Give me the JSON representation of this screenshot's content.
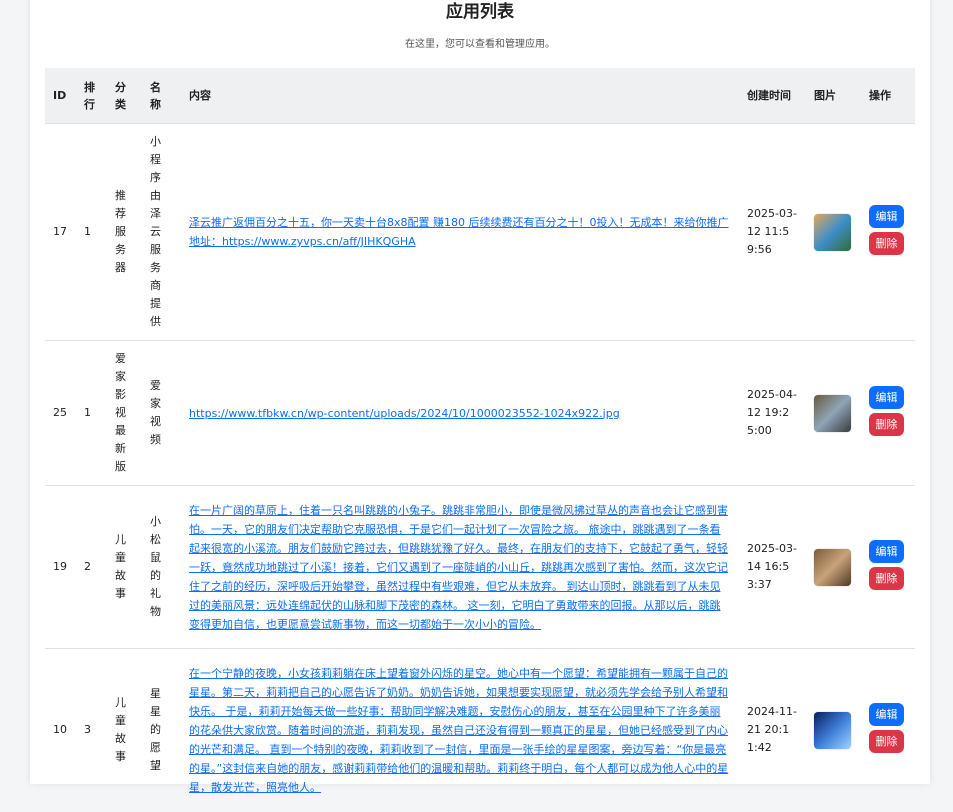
{
  "header": {
    "title": "应用列表",
    "subtitle": "在这里，您可以查看和管理应用。"
  },
  "columns": {
    "id": "ID",
    "rank": "排行",
    "category": "分类",
    "name": "名称",
    "content": "内容",
    "created": "创建时间",
    "image": "图片",
    "actions": "操作"
  },
  "buttons": {
    "edit": "编辑",
    "delete": "删除"
  },
  "rows": [
    {
      "id": "17",
      "rank": "1",
      "category": "推荐服务器",
      "name": "小程序由泽云服务商提供",
      "content": "泽云推广返佣百分之十五，你一天卖十台8x8配置 赚180 后续续费还有百分之十！0投入！无成本！来给你推广地址：https://www.zyvps.cn/aff/JIHKQGHA",
      "created": "2025-03-12 11:59:56",
      "thumb_colors": [
        "#e3a85c",
        "#3f8fc9",
        "#2f6b3a"
      ]
    },
    {
      "id": "25",
      "rank": "1",
      "category": "爱家影视最新版",
      "name": "爱家视频",
      "content": "https://www.tfbkw.cn/wp-content/uploads/2024/10/1000023552-1024x922.jpg",
      "created": "2025-04-12 19:25:00",
      "thumb_colors": [
        "#6a5a3c",
        "#8fa5b8",
        "#3a3a3a"
      ]
    },
    {
      "id": "19",
      "rank": "2",
      "category": "儿童故事",
      "name": "小松鼠的礼物",
      "content": "在一片广阔的草原上，住着一只名叫跳跳的小兔子。跳跳非常胆小，即使是微风拂过草丛的声音也会让它感到害怕。一天，它的朋友们决定帮助它克服恐惧，于是它们一起计划了一次冒险之旅。 旅途中，跳跳遇到了一条看起来很宽的小溪流。朋友们鼓励它跨过去，但跳跳犹豫了好久。最终，在朋友们的支持下，它鼓起了勇气，轻轻一跃，竟然成功地跳过了小溪！接着，它们又遇到了一座陡峭的小山丘，跳跳再次感到了害怕。然而，这次它记住了之前的经历，深呼吸后开始攀登，虽然过程中有些艰难，但它从未放弃。 到达山顶时，跳跳看到了从未见过的美丽风景：远处连绵起伏的山脉和脚下茂密的森林。 这一刻，它明白了勇敢带来的回报。从那以后，跳跳变得更加自信，也更愿意尝试新事物，而这一切都始于一次小小的冒险。",
      "created": "2025-03-14 16:53:37",
      "thumb_colors": [
        "#7a5c3a",
        "#c9a27a",
        "#4d3a24"
      ]
    },
    {
      "id": "10",
      "rank": "3",
      "category": "儿童故事",
      "name": "星星的愿望",
      "content": "在一个宁静的夜晚，小女孩莉莉躺在床上望着窗外闪烁的星空。她心中有一个愿望：希望能拥有一颗属于自己的星星。第二天，莉莉把自己的心愿告诉了奶奶。奶奶告诉她，如果想要实现愿望，就必须先学会给予别人希望和快乐。 于是，莉莉开始每天做一些好事：帮助同学解决难题，安慰伤心的朋友，甚至在公园里种下了许多美丽的花朵供大家欣赏。随着时间的流逝，莉莉发现，虽然自己还没有得到一颗真正的星星，但她已经感受到了内心的光芒和满足。 直到一个特别的夜晚，莉莉收到了一封信，里面是一张手绘的星星图案，旁边写着：“你是最亮的星。”这封信来自她的朋友，感谢莉莉带给他们的温暖和帮助。莉莉终于明白，每个人都可以成为他人心中的星星，散发光芒，照亮他人。",
      "created": "2024-11-21 20:11:42",
      "thumb_colors": [
        "#0b1f5c",
        "#3a7bd5",
        "#9fd3ff"
      ]
    }
  ]
}
